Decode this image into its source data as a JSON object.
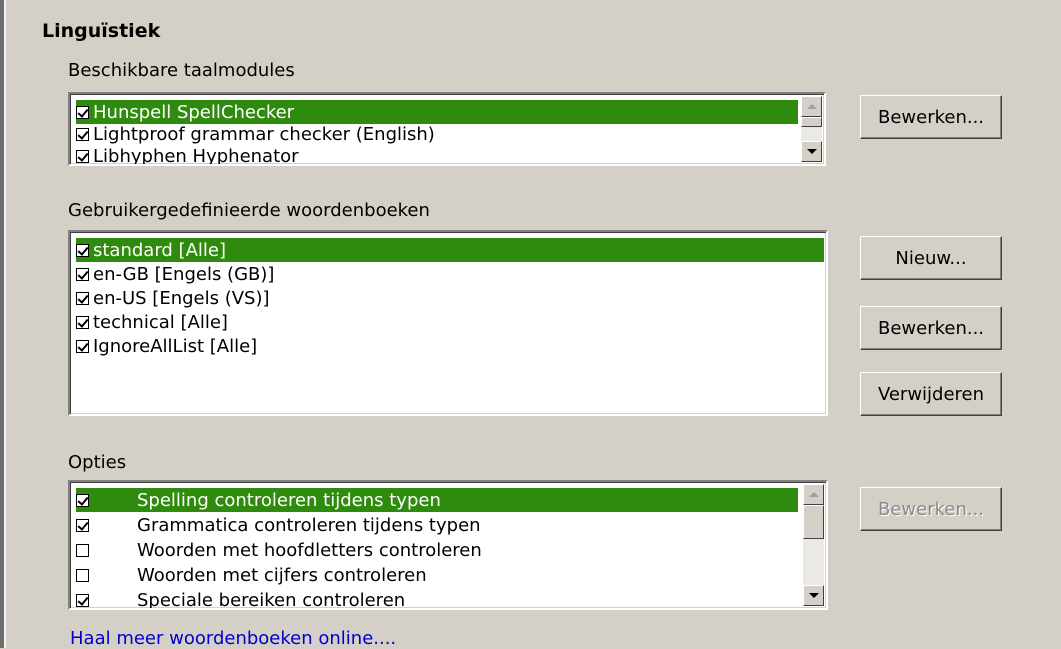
{
  "section_title": "Linguïstiek",
  "modules": {
    "label": "Beschikbare taalmodules",
    "items": [
      {
        "label": "Hunspell SpellChecker",
        "checked": true,
        "selected": true
      },
      {
        "label": "Lightproof grammar checker (English)",
        "checked": true,
        "selected": false
      },
      {
        "label": "Libhyphen Hyphenator",
        "checked": true,
        "selected": false
      }
    ],
    "edit_button": "Bewerken..."
  },
  "dictionaries": {
    "label": "Gebruikergedefinieerde woordenboeken",
    "items": [
      {
        "label": "standard [Alle]",
        "checked": true,
        "selected": true
      },
      {
        "label": "en-GB [Engels (GB)]",
        "checked": true,
        "selected": false
      },
      {
        "label": "en-US [Engels (VS)]",
        "checked": true,
        "selected": false
      },
      {
        "label": "technical [Alle]",
        "checked": true,
        "selected": false
      },
      {
        "label": "IgnoreAllList [Alle]",
        "checked": true,
        "selected": false
      }
    ],
    "new_button": "Nieuw...",
    "edit_button": "Bewerken...",
    "delete_button": "Verwijderen"
  },
  "options": {
    "label": "Opties",
    "items": [
      {
        "label": "Spelling controleren tijdens typen",
        "checked": true,
        "selected": true
      },
      {
        "label": "Grammatica controleren tijdens typen",
        "checked": true,
        "selected": false
      },
      {
        "label": "Woorden met hoofdletters controleren",
        "checked": false,
        "selected": false
      },
      {
        "label": "Woorden met cijfers controleren",
        "checked": false,
        "selected": false
      },
      {
        "label": "Speciale bereiken controleren",
        "checked": true,
        "selected": false
      }
    ],
    "edit_button": "Bewerken..."
  },
  "more_dictionaries_link": "Haal meer woordenboeken online....",
  "colors": {
    "selection": "#2e8b0e",
    "link": "#0000cc",
    "background": "#d4d0c8"
  }
}
